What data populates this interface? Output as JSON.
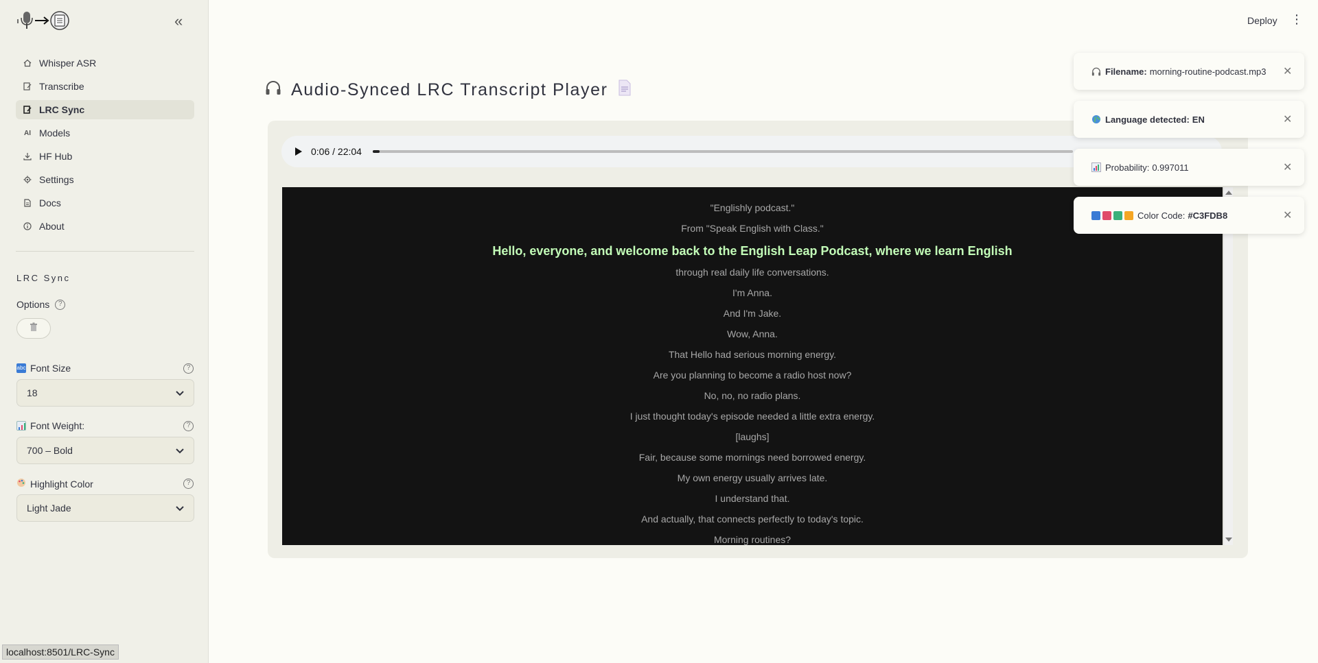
{
  "sidebar": {
    "collapse_icon": "«",
    "items": [
      {
        "label": "Whisper ASR",
        "icon": "home-icon"
      },
      {
        "label": "Transcribe",
        "icon": "edit-doc-icon"
      },
      {
        "label": "LRC Sync",
        "icon": "edit-doc-icon",
        "active": true
      },
      {
        "label": "Models",
        "icon": "ai-icon"
      },
      {
        "label": "HF Hub",
        "icon": "download-icon"
      },
      {
        "label": "Settings",
        "icon": "gear-icon"
      },
      {
        "label": "Docs",
        "icon": "document-icon"
      },
      {
        "label": "About",
        "icon": "info-icon"
      }
    ],
    "section_title": "LRC Sync",
    "options_label": "Options",
    "font_size": {
      "label": "Font Size",
      "value": "18"
    },
    "font_weight": {
      "label": "Font Weight:",
      "value": "700 – Bold"
    },
    "highlight_color": {
      "label": "Highlight Color",
      "value": "Light Jade"
    }
  },
  "status_url": "localhost:8501/LRC-Sync",
  "header": {
    "deploy_label": "Deploy",
    "menu_icon": "⋮"
  },
  "title": "Audio-Synced LRC Transcript Player",
  "player": {
    "time": "0:06 / 22:04",
    "progress": 0.005
  },
  "lyrics": {
    "highlight_color": "#C3FDB8",
    "lines": [
      "\"Englishly podcast.\"",
      "From \"Speak English with Class.\"",
      "Hello, everyone, and welcome back to the English Leap Podcast, where we learn English",
      "through real daily life conversations.",
      "I'm Anna.",
      "And I'm Jake.",
      "Wow, Anna.",
      "That Hello had serious morning energy.",
      "Are you planning to become a radio host now?",
      "No, no, no radio plans.",
      "I just thought today's episode needed a little extra energy.",
      "[laughs]",
      "Fair, because some mornings need borrowed energy.",
      "My own energy usually arrives late.",
      "I understand that.",
      "And actually, that connects perfectly to today's topic.",
      "Morning routines?"
    ],
    "active_index": 2
  },
  "toasts": [
    {
      "label": "Filename:",
      "value": "morning-routine-podcast.mp3",
      "icon": "headphones-icon"
    },
    {
      "label": "Language detected:",
      "value": "EN",
      "icon": "globe-icon"
    },
    {
      "label": "Probability:",
      "value": "0.997011",
      "icon": "bar-chart-icon"
    },
    {
      "label": "Color Code:",
      "value": "#C3FDB8",
      "icon": "color-squares-icon"
    }
  ]
}
